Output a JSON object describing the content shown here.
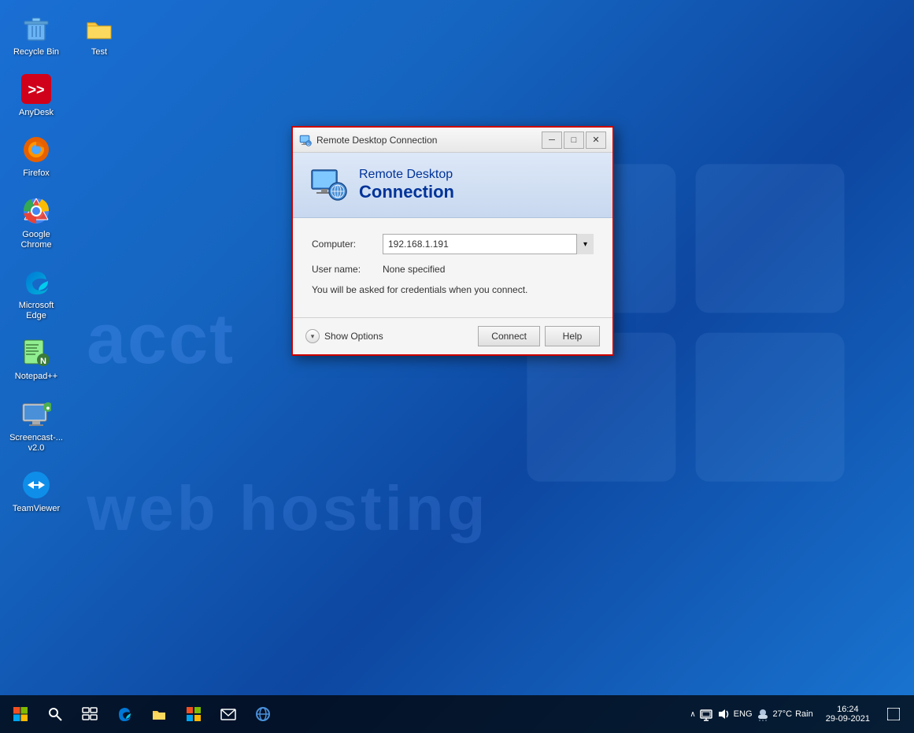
{
  "desktop": {
    "background_color": "#1565c0",
    "watermark1": "acct",
    "watermark2": "web hosting"
  },
  "icons": [
    {
      "id": "recycle-bin",
      "label": "Recycle Bin",
      "row": 0,
      "col": 0
    },
    {
      "id": "test-folder",
      "label": "Test",
      "row": 0,
      "col": 1
    },
    {
      "id": "anydesk",
      "label": "AnyDesk",
      "row": 1,
      "col": 0
    },
    {
      "id": "firefox",
      "label": "Firefox",
      "row": 2,
      "col": 0
    },
    {
      "id": "google-chrome",
      "label": "Google Chrome",
      "row": 3,
      "col": 0
    },
    {
      "id": "microsoft-edge",
      "label": "Microsoft Edge",
      "row": 4,
      "col": 0
    },
    {
      "id": "notepadpp",
      "label": "Notepad++",
      "row": 5,
      "col": 0
    },
    {
      "id": "screencast",
      "label": "Screencast-... v2.0",
      "row": 6,
      "col": 0
    },
    {
      "id": "teamviewer",
      "label": "TeamViewer",
      "row": 7,
      "col": 0
    }
  ],
  "dialog": {
    "title": "Remote Desktop Connection",
    "minimize_label": "─",
    "maximize_label": "□",
    "close_label": "✕",
    "banner": {
      "line1": "Remote Desktop",
      "line2": "Connection"
    },
    "fields": {
      "computer_label": "Computer:",
      "computer_value": "192.168.1.191",
      "username_label": "User name:",
      "username_value": "None specified",
      "note": "You will be asked for credentials when you connect."
    },
    "footer": {
      "show_options_label": "Show Options",
      "connect_label": "Connect",
      "help_label": "Help"
    }
  },
  "taskbar": {
    "tray": {
      "weather_icon": "☁",
      "temperature": "27°C",
      "condition": "Rain",
      "chevron": "∧",
      "network_icon": "🖥",
      "volume_icon": "🔊",
      "language": "ENG",
      "time": "16:24",
      "date": "29-09-2021",
      "notification_icon": "□"
    }
  }
}
